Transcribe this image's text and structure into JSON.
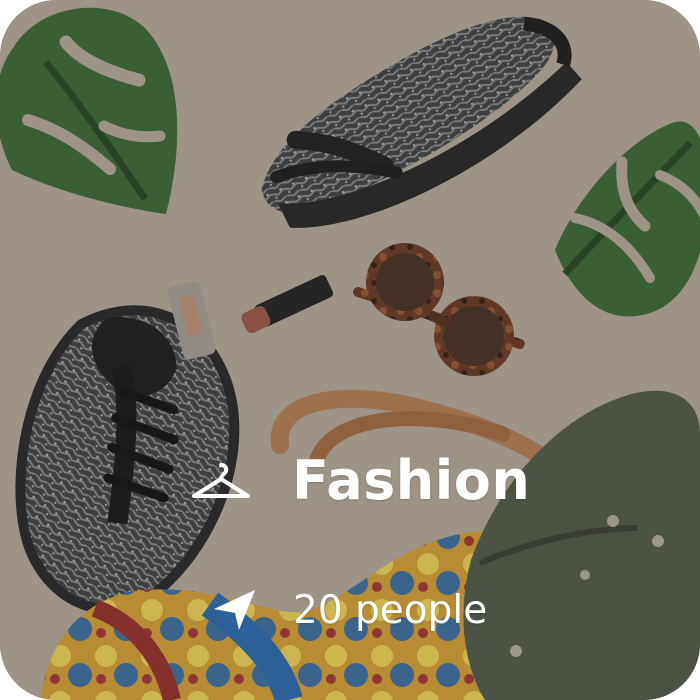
{
  "card": {
    "category_label": "Fashion",
    "people_label": "20 people",
    "icons": {
      "category": "hanger-icon",
      "people": "send-arrow-icon"
    }
  },
  "colors": {
    "text": "#ffffff",
    "background": "#b7ac9f",
    "leaf": "#3f6d39",
    "shoe": "#2e2f33",
    "bag_strap": "#b88259",
    "bag": "#555d4d"
  }
}
